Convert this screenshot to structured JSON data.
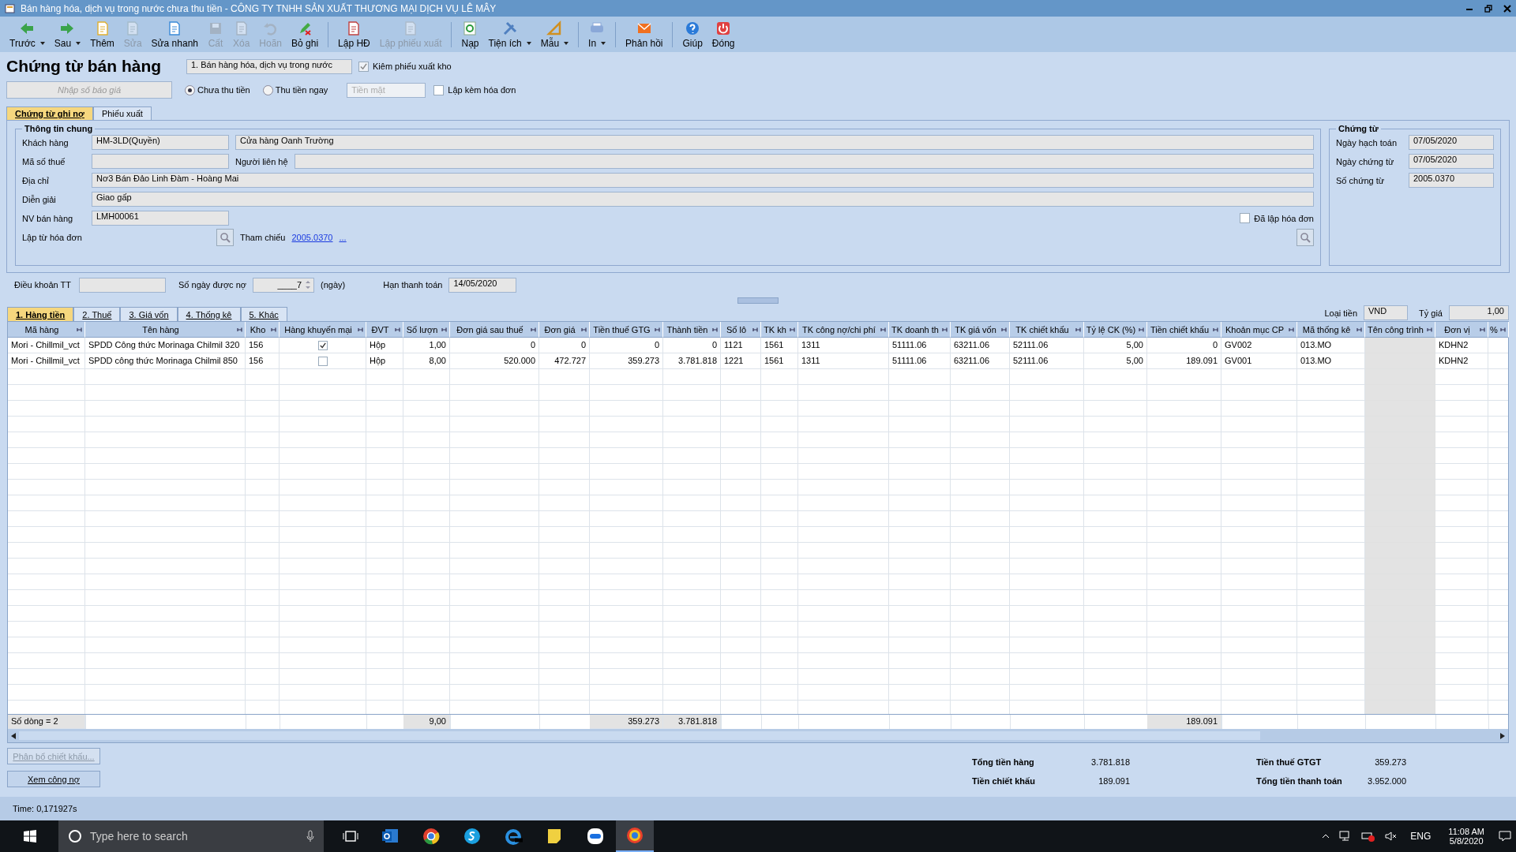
{
  "window": {
    "title": "Bán hàng hóa, dịch vụ trong nước chưa thu tiền - CÔNG TY TNHH SẢN XUẤT THƯƠNG MẠI DỊCH VỤ LÊ MÂY"
  },
  "toolbar": [
    {
      "items": [
        {
          "label": "Trước",
          "disabled": false,
          "dropdown": true
        },
        {
          "label": "Sau",
          "disabled": false,
          "dropdown": true
        },
        {
          "label": "Thêm",
          "disabled": false,
          "dropdown": false
        },
        {
          "label": "Sửa",
          "disabled": true,
          "dropdown": false
        },
        {
          "label": "Sửa nhanh",
          "disabled": false,
          "dropdown": false
        },
        {
          "label": "Cất",
          "disabled": true,
          "dropdown": false
        },
        {
          "label": "Xóa",
          "disabled": true,
          "dropdown": false
        },
        {
          "label": "Hoãn",
          "disabled": true,
          "dropdown": false
        },
        {
          "label": "Bỏ ghi",
          "disabled": false,
          "dropdown": false
        }
      ]
    },
    {
      "items": [
        {
          "label": "Lập HĐ",
          "disabled": false,
          "dropdown": false
        },
        {
          "label": "Lập phiếu xuất",
          "disabled": true,
          "dropdown": false
        }
      ]
    },
    {
      "items": [
        {
          "label": "Nạp",
          "disabled": false,
          "dropdown": false
        },
        {
          "label": "Tiện ích",
          "disabled": false,
          "dropdown": true
        },
        {
          "label": "Mẫu",
          "disabled": false,
          "dropdown": true
        }
      ]
    },
    {
      "items": [
        {
          "label": "In",
          "disabled": false,
          "dropdown": true
        }
      ]
    },
    {
      "items": [
        {
          "label": "Phản hồi",
          "disabled": false,
          "dropdown": false
        }
      ]
    },
    {
      "items": [
        {
          "label": "Giúp",
          "disabled": false,
          "dropdown": false
        },
        {
          "label": "Đóng",
          "disabled": false,
          "dropdown": false
        }
      ]
    }
  ],
  "heading": "Chứng từ bán hàng",
  "voucher_type": "1. Bán hàng hóa, dịch vụ trong nước",
  "export_checkbox": {
    "label": "Kiêm phiếu xuất kho",
    "checked": true
  },
  "quote_field": {
    "placeholder": "Nhập số báo giá"
  },
  "payment_options": [
    {
      "label": "Chưa thu tiền",
      "selected": true
    },
    {
      "label": "Thu tiền ngay",
      "selected": false
    }
  ],
  "payment_method": {
    "placeholder": "Tiền mặt",
    "disabled": true
  },
  "invoice_checkbox": {
    "label": "Lập kèm hóa đơn",
    "checked": false
  },
  "tabs": [
    {
      "label": "Chứng từ ghi nợ",
      "selected": true
    },
    {
      "label": "Phiếu xuất",
      "selected": false
    }
  ],
  "general": {
    "title": "Thông tin chung",
    "customer": {
      "label": "Khách hàng",
      "code": "HM-3LD(Quyền)",
      "name": "Cửa hàng Oanh Trường"
    },
    "tax_code": {
      "label": "Mã số thuế"
    },
    "contact": {
      "label": "Người liên hệ"
    },
    "address": {
      "label": "Địa chỉ",
      "value": "Nơ3 Bán Đảo Linh Đàm - Hoàng Mai"
    },
    "description": {
      "label": "Diễn giải",
      "value": "Giao gấp"
    },
    "salesperson": {
      "label": "NV bán hàng",
      "value": "LMH00061"
    },
    "from_invoice": {
      "label": "Lập từ hóa đơn"
    },
    "reference": {
      "label": "Tham chiếu",
      "link": "2005.0370",
      "more": "..."
    },
    "invoiced": {
      "label": "Đã lập hóa đơn",
      "checked": false
    }
  },
  "voucher": {
    "title": "Chứng từ",
    "fields": [
      {
        "label": "Ngày hạch toán",
        "value": "07/05/2020"
      },
      {
        "label": "Ngày chứng từ",
        "value": "07/05/2020"
      },
      {
        "label": "Số chứng từ",
        "value": "2005.0370"
      }
    ]
  },
  "terms": {
    "label": "Điều khoản TT",
    "days_label": "Số ngày được nợ",
    "days": "____7",
    "days_unit": "(ngày)",
    "due_label": "Hạn thanh toán",
    "due": "14/05/2020"
  },
  "grid_tabs": [
    {
      "label": "1. Hàng tiền",
      "selected": true
    },
    {
      "label": "2. Thuế",
      "selected": false
    },
    {
      "label": "3. Giá vốn",
      "selected": false
    },
    {
      "label": "4. Thống kê",
      "selected": false
    },
    {
      "label": "5. Khác",
      "selected": false
    }
  ],
  "currency": {
    "label": "Loại tiền",
    "value": "VND",
    "rate_label": "Tỷ giá",
    "rate": "1,00"
  },
  "columns": [
    {
      "label": "Mã hàng",
      "kind": "text"
    },
    {
      "label": "Tên hàng",
      "kind": "text"
    },
    {
      "label": "Kho",
      "kind": "text"
    },
    {
      "label": "Hàng khuyến mại",
      "kind": "check"
    },
    {
      "label": "ĐVT",
      "kind": "text"
    },
    {
      "label": "Số lượn",
      "kind": "num"
    },
    {
      "label": "Đơn giá sau thuế",
      "kind": "num"
    },
    {
      "label": "Đơn giá",
      "kind": "num"
    },
    {
      "label": "Tiền thuế GTG",
      "kind": "num"
    },
    {
      "label": "Thành tiền",
      "kind": "num"
    },
    {
      "label": "Số lô",
      "kind": "text"
    },
    {
      "label": "TK kh",
      "kind": "text"
    },
    {
      "label": "TK công nợ/chi phí",
      "kind": "text"
    },
    {
      "label": "TK doanh th",
      "kind": "text"
    },
    {
      "label": "TK giá vốn",
      "kind": "text"
    },
    {
      "label": "TK chiết khấu",
      "kind": "text"
    },
    {
      "label": "Tỷ lệ CK (%)",
      "kind": "num"
    },
    {
      "label": "Tiền chiết khấu",
      "kind": "num"
    },
    {
      "label": "Khoản mục CP",
      "kind": "text"
    },
    {
      "label": "Mã thống kê",
      "kind": "text"
    },
    {
      "label": "Tên công trình",
      "kind": "shade"
    },
    {
      "label": "Đơn vị",
      "kind": "text"
    },
    {
      "label": "%",
      "kind": "blank"
    }
  ],
  "rows": [
    {
      "promo": true,
      "cells": [
        "Mori - Chillmil_vct",
        "SPDD Công thức Morinaga Chilmil 320",
        "156",
        "Hộp",
        "1,00",
        "0",
        "0",
        "0",
        "0",
        "1121",
        "1561",
        "1311",
        "51111.06",
        "63211.06",
        "52111.06",
        "5,00",
        "0",
        "GV002",
        "013.MO",
        "KDHN2"
      ]
    },
    {
      "promo": false,
      "cells": [
        "Mori - Chillmil_vct",
        "SPDD công thức Morinaga Chilmil  850",
        "156",
        "Hộp",
        "8,00",
        "520.000",
        "472.727",
        "359.273",
        "3.781.818",
        "1221",
        "1561",
        "1311",
        "51111.06",
        "63211.06",
        "52111.06",
        "5,00",
        "189.091",
        "GV001",
        "013.MO",
        "KDHN2"
      ]
    }
  ],
  "footer": {
    "row_count": "Số dòng = 2",
    "quantity": "9,00",
    "tax": "359.273",
    "amount": "3.781.818",
    "discount": "189.091"
  },
  "buttons": [
    {
      "label": "Phân bổ chiết khấu...",
      "disabled": true
    },
    {
      "label": "Xem công nợ",
      "disabled": false
    }
  ],
  "totals": [
    {
      "label": "Tổng tiền hàng",
      "value": "3.781.818"
    },
    {
      "label": "Tiền thuế GTGT",
      "value": "359.273"
    },
    {
      "label": "Tiền chiết khấu",
      "value": "189.091"
    },
    {
      "label": "Tổng tiền thanh toán",
      "value": "3.952.000"
    }
  ],
  "status_bar": "Time: 0,171927s",
  "taskbar": {
    "search": {
      "placeholder": "Type here to search"
    },
    "language": "ENG",
    "time": "11:08 AM",
    "date": "5/8/2020"
  }
}
